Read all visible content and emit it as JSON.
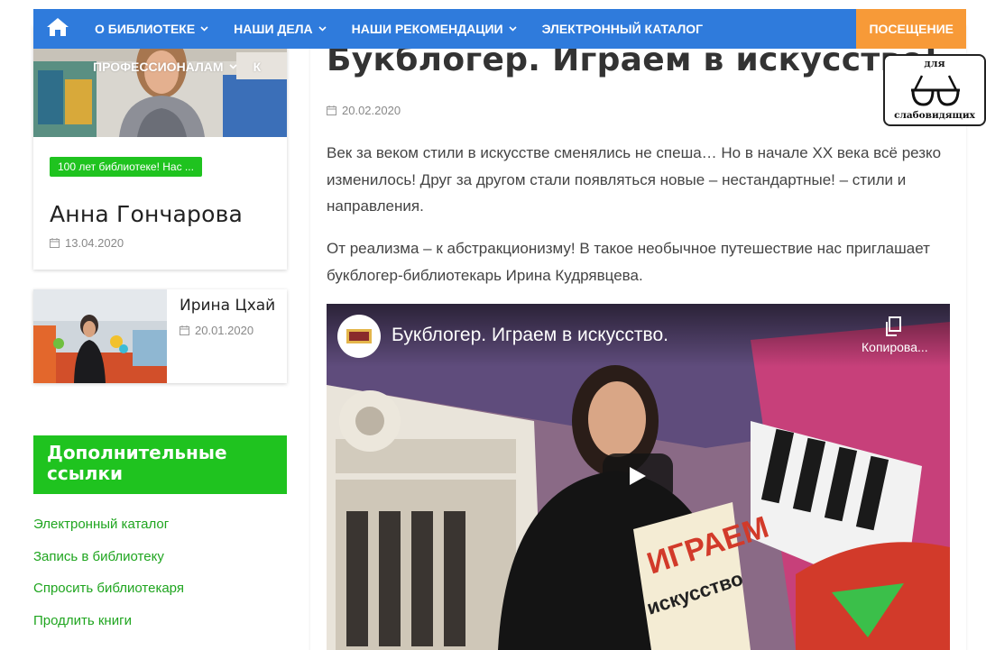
{
  "nav": {
    "items": [
      {
        "label": "О БИБЛИОТЕКЕ",
        "has_dropdown": true
      },
      {
        "label": "НАШИ ДЕЛА",
        "has_dropdown": true
      },
      {
        "label": "НАШИ РЕКОМЕНДАЦИИ",
        "has_dropdown": true
      },
      {
        "label": "ЭЛЕКТРОННЫЙ КАТАЛОГ",
        "has_dropdown": false
      }
    ],
    "visit_label": "ПОСЕЩЕНИЕ",
    "sub_item": "ПРОФЕССИОНАЛАМ",
    "sub_partial": "К",
    "colors": {
      "bar": "#2f7bdc",
      "visit": "#f79a38"
    }
  },
  "sidebar": {
    "featured": {
      "tag": "100 лет библиотеке! Нас ...",
      "name": "Анна Гончарова",
      "date": "13.04.2020"
    },
    "small": {
      "name": "Ирина Цхай",
      "date": "20.01.2020"
    },
    "links_heading": "Дополнительные ссылки",
    "links": [
      "Электронный каталог",
      "Запись в библиотеку",
      "Спросить библиотекаря",
      "Продлить книги"
    ],
    "accent": "#1fc31f"
  },
  "article": {
    "title": "Букблогер. Играем в искусство!",
    "date": "20.02.2020",
    "p1": "Век за веком стили в искусстве сменялись не спеша… Но в начале XX века всё резко изменилось! Друг за другом стали появляться новые – нестандартные! – стили и направления.",
    "p2": "От реализма – к абстракционизму! В такое необычное путешествие нас приглашает букблогер-библиотекарь Ирина Кудрявцева."
  },
  "video": {
    "title": "Букблогер. Играем в искусство.",
    "copy_label": "Копирова..."
  },
  "a11y": {
    "top": "для",
    "bottom": "слабовидящих"
  }
}
